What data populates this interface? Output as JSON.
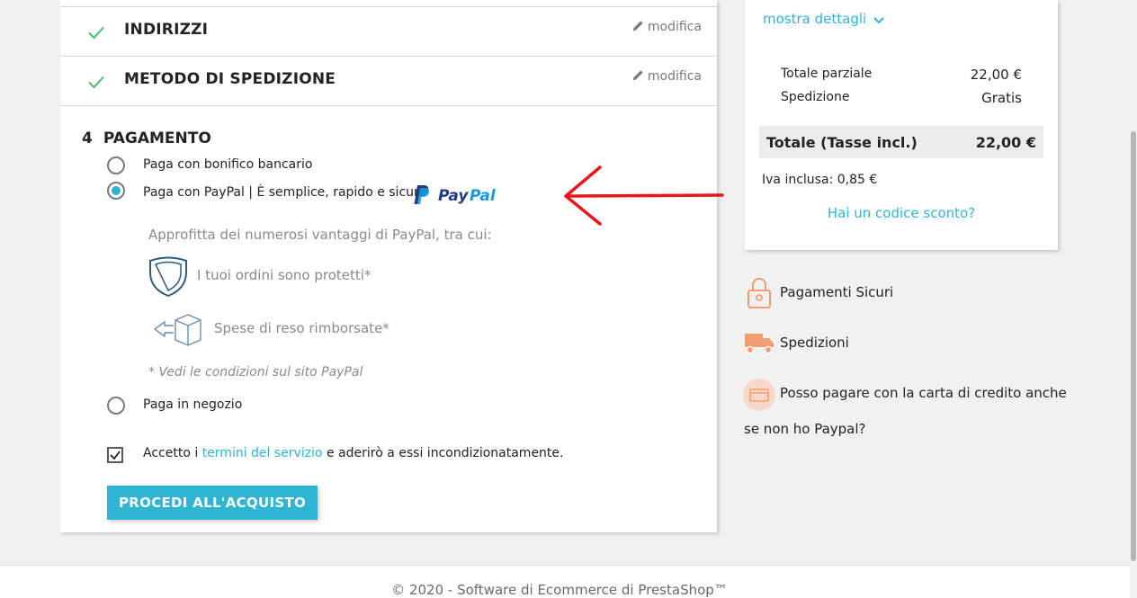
{
  "checkout": {
    "steps_done": [
      {
        "title": "INDIRIZZI",
        "edit_label": "modifica"
      },
      {
        "title": "METODO DI SPEDIZIONE",
        "edit_label": "modifica"
      }
    ],
    "payment": {
      "step_number": "4",
      "title": "PAGAMENTO",
      "options": [
        {
          "label": "Paga con bonifico bancario",
          "selected": false
        },
        {
          "label": "Paga con PayPal | È semplice, rapido e sicuro",
          "selected": true
        },
        {
          "label": "Paga in negozio",
          "selected": false
        }
      ],
      "paypal_logo_text": "PayPal",
      "paypal_info": {
        "intro": "Approfitta dei numerosi vantaggi di PayPal, tra cui:",
        "benefit_protected": "I tuoi ordini sono protetti*",
        "benefit_returns": "Spese di reso rimborsate*",
        "note": "* Vedi le condizioni sul sito PayPal"
      },
      "terms": {
        "prefix": "Accetto i",
        "link": "termini del servizio",
        "suffix": "e aderirò a essi incondizionatamente.",
        "checked": true
      },
      "submit_label": "PROCEDI ALL'ACQUISTO"
    }
  },
  "summary": {
    "show_details": "mostra dettagli",
    "subtotal_label": "Totale parziale",
    "subtotal_value": "22,00 €",
    "shipping_label": "Spedizione",
    "shipping_value": "Gratis",
    "total_label": "Totale (Tasse incl.)",
    "total_value": "22,00 €",
    "tax_line": "Iva inclusa: 0,85 €",
    "promo_link": "Hai un codice sconto?"
  },
  "reassurance": [
    {
      "icon": "lock-icon",
      "text": "Pagamenti Sicuri"
    },
    {
      "icon": "truck-icon",
      "text": "Spedizioni"
    },
    {
      "icon": "credit-card-icon",
      "text_line1": "Posso pagare con la carta di credito anche",
      "text_line2": "se non ho Paypal?"
    }
  ],
  "footer": {
    "text": "© 2020 - Software di Ecommerce di PrestaShop™"
  },
  "colors": {
    "accent": "#2fb5d2",
    "check": "#4cbb6c",
    "arrow": "#e8171c",
    "reassurance_icon": "#f39d72"
  }
}
